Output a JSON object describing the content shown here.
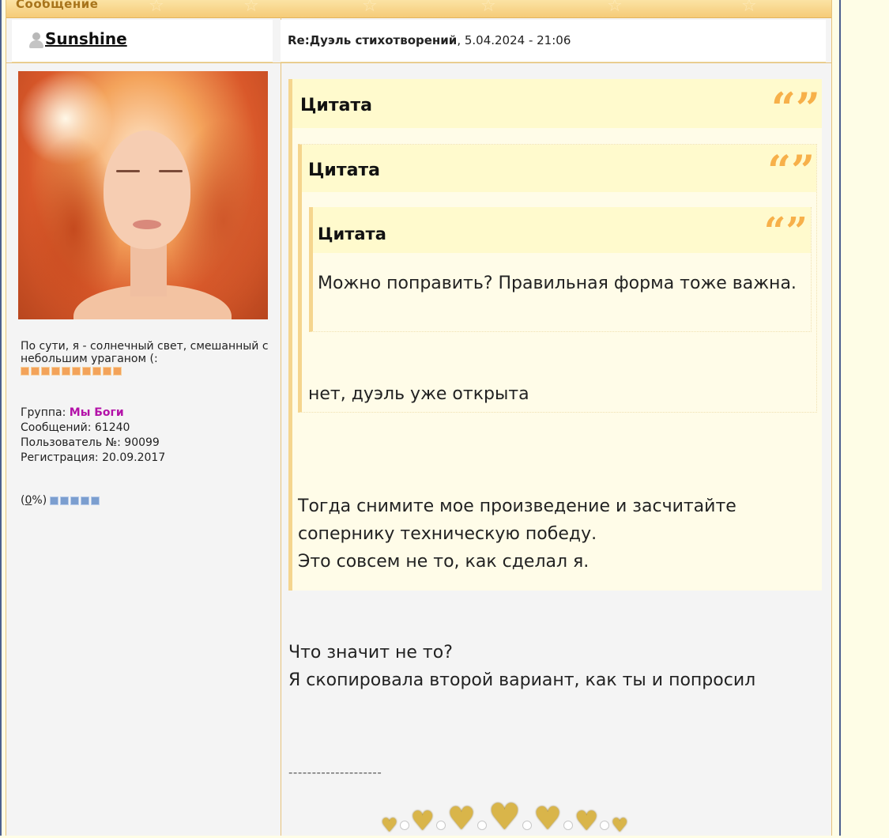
{
  "header": {
    "title": "Сообщение"
  },
  "author": {
    "name": "Sunshine",
    "status_text": "По сути, я - солнечный свет, смешанный с небольшим ураганом (:",
    "group_label": "Группа:",
    "group_value": "Мы Боги",
    "posts_label": "Сообщений:",
    "posts_value": "61240",
    "user_no_label": "Пользователь №:",
    "user_no_value": "90099",
    "reg_label": "Регистрация:",
    "reg_value": "20.09.2017",
    "reputation_open": "(",
    "reputation_link": "0",
    "reputation_close": "%)"
  },
  "post": {
    "topic": "Re:Дуэль стихотворений",
    "date": ", 5.04.2024 - 21:06",
    "quote_label": "Цитата",
    "quote3_text": "Можно поправить? Правильная форма тоже важна.",
    "quote2_text": "нет, дуэль уже открыта",
    "quote1_text_line1": "Тогда снимите мое произведение и засчитайте сопернику техническую победу.",
    "quote1_text_line2": "Это совсем не то, как сделал я.",
    "reply_line1": "Что значит не то?",
    "reply_line2": "Я скопировала второй вариант, как ты и попросил",
    "signature_line": "--------------------"
  },
  "colors": {
    "accent": "#f5cb78",
    "group": "#b312a8",
    "quote_mark": "#f7b04a"
  }
}
